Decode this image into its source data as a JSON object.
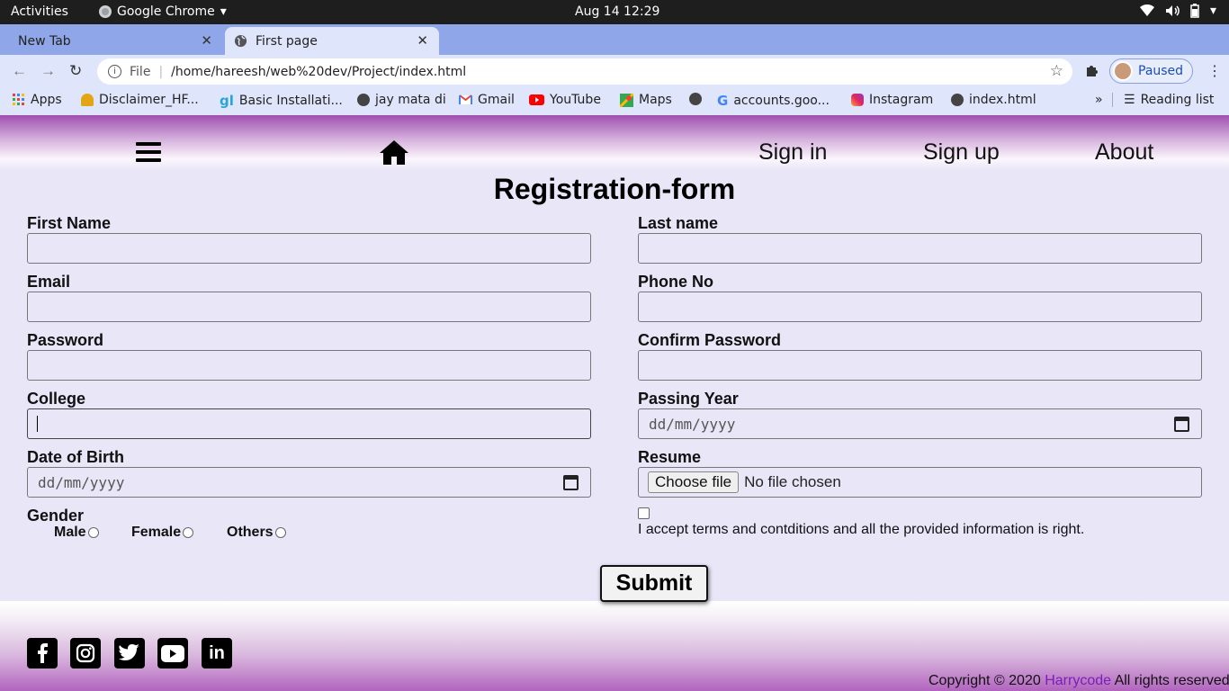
{
  "system_bar": {
    "activities": "Activities",
    "app_name": "Google Chrome",
    "clock": "Aug 14  12:29"
  },
  "tabs": [
    {
      "title": "New Tab",
      "active": false
    },
    {
      "title": "First page",
      "active": true
    }
  ],
  "toolbar": {
    "url_scheme": "File",
    "url": "/home/hareesh/web%20dev/Project/index.html",
    "profile_status": "Paused"
  },
  "bookmarks": [
    {
      "label": "Apps",
      "icon": "apps-grid-icon"
    },
    {
      "label": "Disclaimer_HF...",
      "icon": "bookmark-icon"
    },
    {
      "label": "Basic Installati...",
      "icon": "bookmark-icon"
    },
    {
      "label": "jay mata di",
      "icon": "globe-icon"
    },
    {
      "label": "Gmail",
      "icon": "gmail-icon"
    },
    {
      "label": "YouTube",
      "icon": "youtube-icon"
    },
    {
      "label": "Maps",
      "icon": "maps-icon"
    },
    {
      "label": "accounts.goo...",
      "icon": "google-icon"
    },
    {
      "label": "Instagram",
      "icon": "instagram-icon"
    },
    {
      "label": "index.html",
      "icon": "globe-icon"
    }
  ],
  "reading_list": "Reading list",
  "nav": {
    "signin": "Sign in",
    "signup": "Sign up",
    "about": "About"
  },
  "form": {
    "title": "Registration-form",
    "first_name": "First Name",
    "last_name": "Last name",
    "email": "Email",
    "phone": "Phone No",
    "password": "Password",
    "confirm_password": "Confirm Password",
    "college": "College",
    "passing_year": "Passing Year",
    "passing_year_placeholder": "dd/mm/yyyy",
    "dob": "Date of Birth",
    "dob_placeholder": "dd/mm/yyyy",
    "resume": "Resume",
    "choose_file": "Choose file",
    "no_file": "No file chosen",
    "gender": "Gender",
    "gender_male": "Male",
    "gender_female": "Female",
    "gender_others": "Others",
    "terms": "I accept terms and contditions and all the provided information is right.",
    "submit": "Submit"
  },
  "footer": {
    "social_icons": [
      "facebook-icon",
      "instagram-icon",
      "twitter-icon",
      "youtube-icon",
      "linkedin-icon"
    ],
    "copyright_prefix": "Copyright © 2020",
    "brand": "Harrycode",
    "copyright_suffix": "All rights reserved"
  }
}
